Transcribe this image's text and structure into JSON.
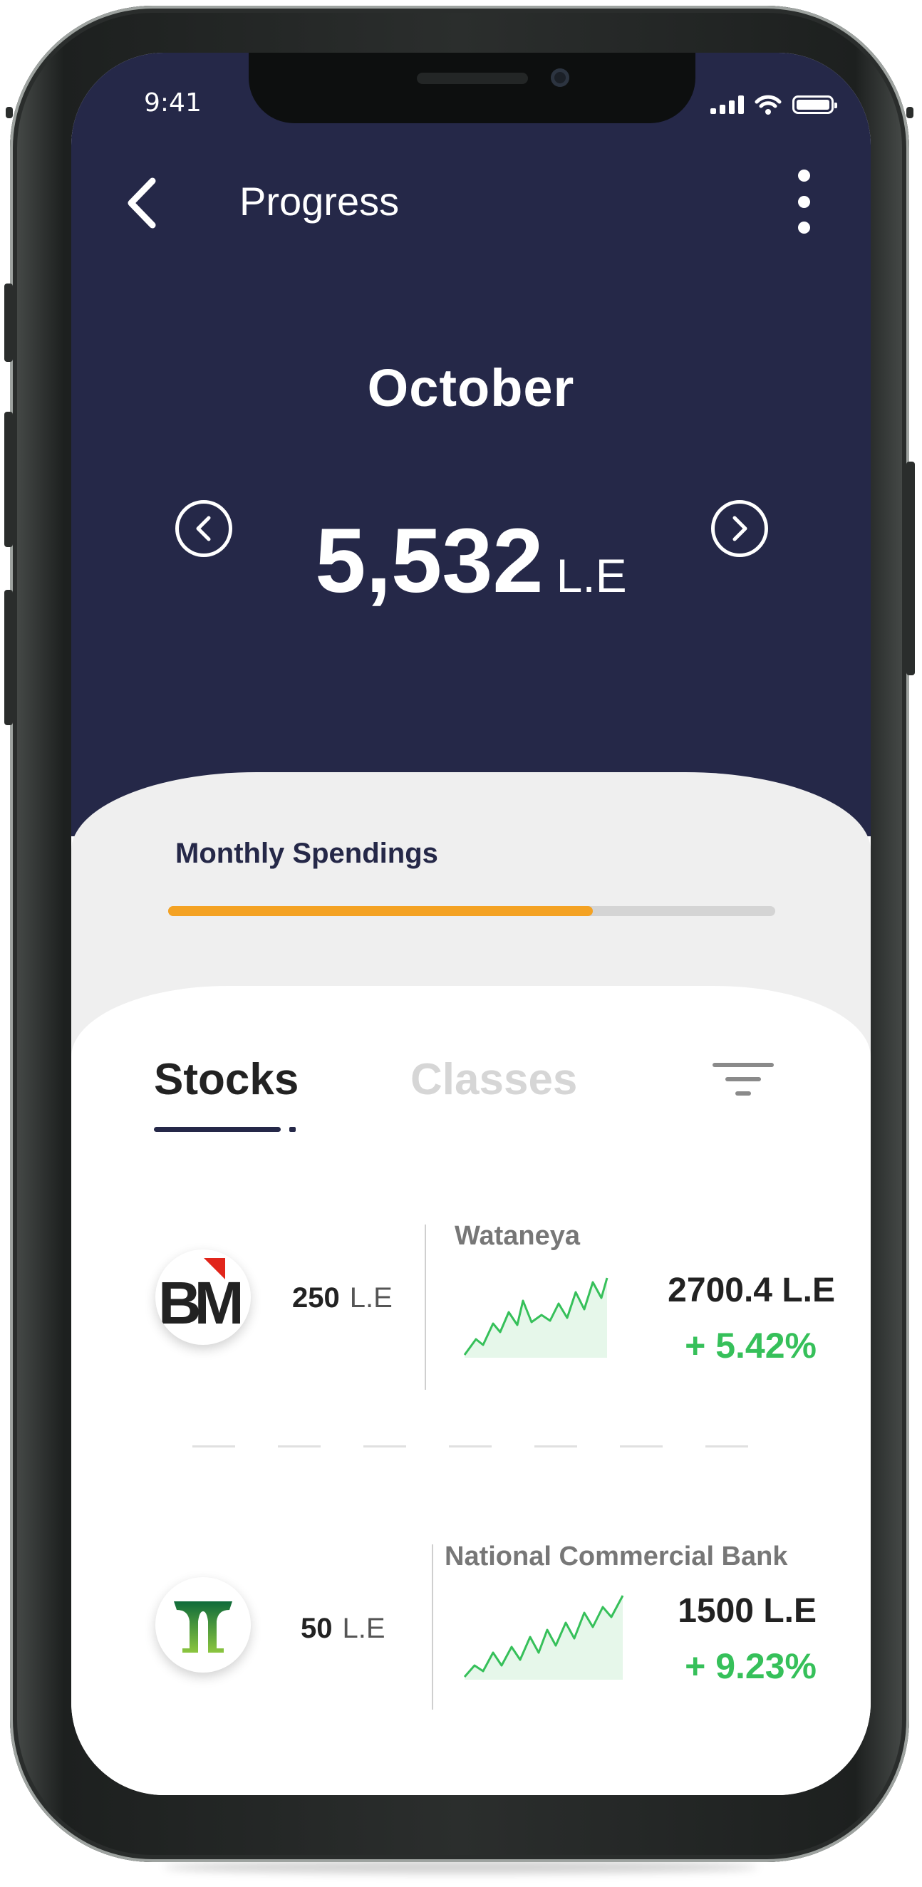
{
  "status_bar": {
    "time": "9:41"
  },
  "nav": {
    "title": "Progress"
  },
  "summary": {
    "month": "October",
    "amount": "5,532",
    "unit": "L.E"
  },
  "spending": {
    "label": "Monthly Spendings",
    "progress": 0.7,
    "fill_color": "#f4a223"
  },
  "tabs": [
    {
      "label": "Stocks",
      "active": true
    },
    {
      "label": "Classes",
      "active": false
    }
  ],
  "stocks": [
    {
      "logo": "bm-logo",
      "buy_amount": "250",
      "buy_unit": "L.E",
      "name": "Wataneya",
      "price": "2700.4 L.E",
      "change": "+ 5.42%",
      "trend_color": "#36c05a"
    },
    {
      "logo": "ncb-logo",
      "buy_amount": "50",
      "buy_unit": "L.E",
      "name": "National Commercial Bank",
      "price": "1500 L.E",
      "change": "+ 9.23%",
      "trend_color": "#36c05a"
    }
  ],
  "colors": {
    "header_bg": "#252848",
    "accent": "#f4a223",
    "positive": "#36c05a"
  },
  "icons": [
    "back-chevron-icon",
    "more-vertical-icon",
    "chevron-left-circle-icon",
    "chevron-right-circle-icon",
    "filter-icon",
    "signal-icon",
    "wifi-icon",
    "battery-icon"
  ]
}
